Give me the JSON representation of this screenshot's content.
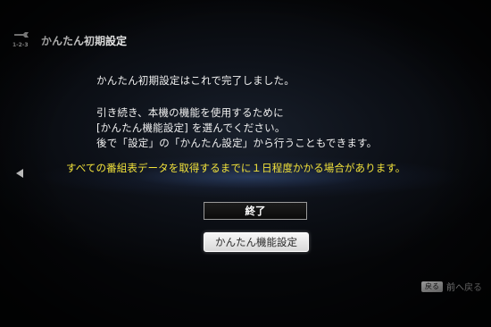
{
  "header": {
    "icon": "wrench-icon",
    "steps": "1-2-3",
    "title": "かんたん初期設定"
  },
  "messages": {
    "complete": "かんたん初期設定はこれで完了しました。",
    "line1": "引き続き、本機の機能を使用するために",
    "line2": "[かんたん機能設定] を選んでください。",
    "line3": "後で「設定」の「かんたん設定」から行うこともできます。"
  },
  "notice": "すべての番組表データを取得するまでに１日程度かかる場合があります。",
  "nav": {
    "left_arrow": "left-arrow-icon"
  },
  "buttons": {
    "end_label": "終了",
    "easy_function_label": "かんたん機能設定"
  },
  "footer": {
    "key_label": "戻る",
    "action_label": "前へ戻る"
  },
  "colors": {
    "notice": "#f2e23a",
    "background": "#050608",
    "text": "#f0f0f0"
  }
}
